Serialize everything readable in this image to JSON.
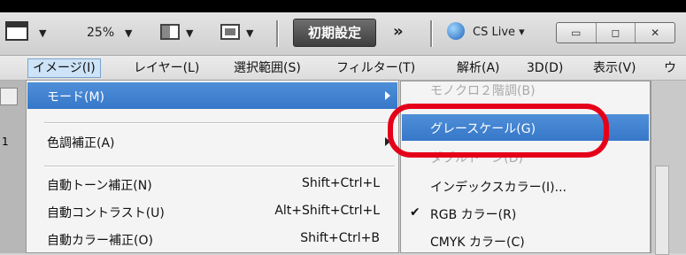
{
  "options_bar": {
    "zoom": "25%",
    "workspace_button": "初期設定",
    "more_glyph": "»",
    "cs_live": "CS Live ▾",
    "window_controls": [
      "▭",
      "◻",
      "✕"
    ]
  },
  "menubar": {
    "items": [
      {
        "label": "イメージ(I)",
        "active": true
      },
      {
        "label": "レイヤー(L)"
      },
      {
        "label": "選択範囲(S)"
      },
      {
        "label": "フィルター(T)"
      },
      {
        "label": "解析(A)"
      },
      {
        "label": "3D(D)"
      },
      {
        "label": "表示(V)"
      },
      {
        "label": "ウ"
      }
    ]
  },
  "image_menu": {
    "items": [
      {
        "label": "モード(M)",
        "submenu": true,
        "highlighted": true
      },
      {
        "label": "色調補正(A)",
        "submenu": true
      },
      {
        "label": "自動トーン補正(N)",
        "shortcut": "Shift+Ctrl+L"
      },
      {
        "label": "自動コントラスト(U)",
        "shortcut": "Alt+Shift+Ctrl+L"
      },
      {
        "label": "自動カラー補正(O)",
        "shortcut": "Shift+Ctrl+B"
      }
    ]
  },
  "mode_submenu": {
    "items": [
      {
        "label": "モノクロ２階調(B)",
        "disabled": true
      },
      {
        "label": "グレースケール(G)",
        "highlighted": true
      },
      {
        "label": "ダブルトーン(D)",
        "disabled": true
      },
      {
        "label": "インデックスカラー(I)..."
      },
      {
        "label": "RGB カラー(R)",
        "checked": true
      },
      {
        "label": "CMYK カラー(C)"
      }
    ]
  },
  "workspace": {
    "tab_number": "1"
  },
  "colors": {
    "highlight": "#3677c9",
    "annotation": "#e5001a"
  }
}
